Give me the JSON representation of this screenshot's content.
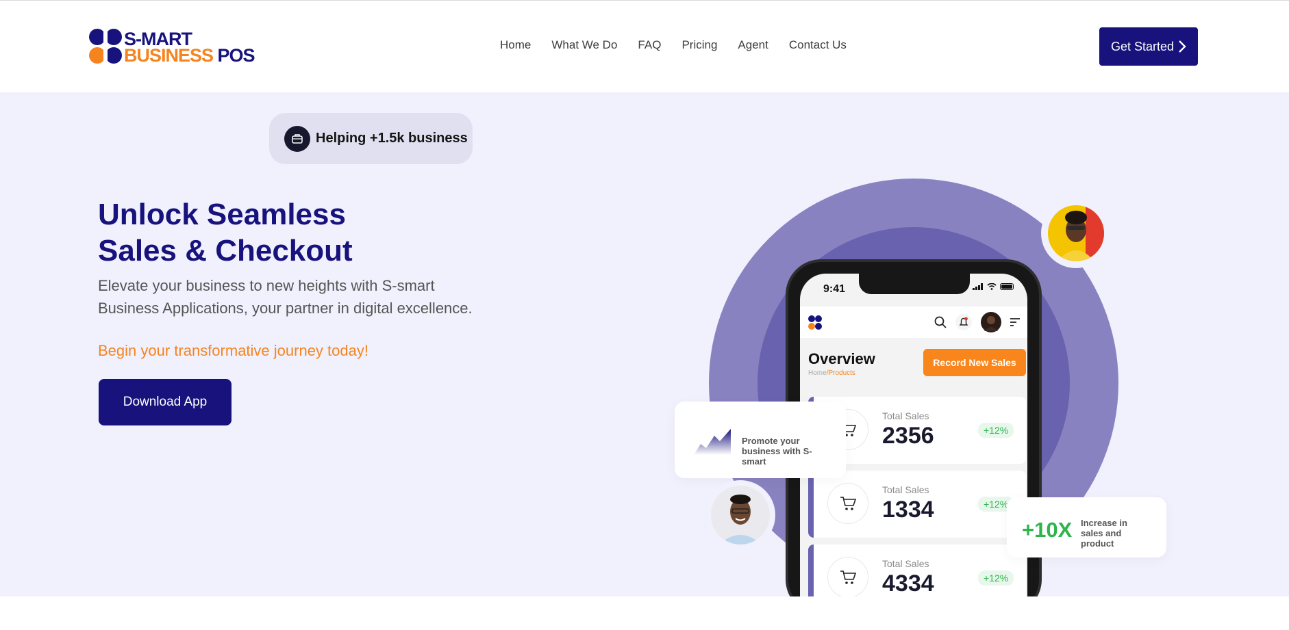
{
  "brand": {
    "line1": "S-MART",
    "line2_a": "BUSINESS",
    "line2_b": " POS",
    "colors": {
      "navy": "#17127c",
      "orange": "#f5841f"
    }
  },
  "nav": {
    "items": [
      {
        "label": "Home"
      },
      {
        "label": "What We Do"
      },
      {
        "label": "FAQ"
      },
      {
        "label": "Pricing"
      },
      {
        "label": "Agent"
      },
      {
        "label": "Contact Us"
      }
    ],
    "cta_label": "Get Started",
    "cta_icon": "chevron-right-icon"
  },
  "hero": {
    "badge": {
      "icon": "briefcase-icon",
      "text": "Helping +1.5k business"
    },
    "headline_line1": "Unlock Seamless",
    "headline_line2": "Sales & Checkout",
    "subtext": "Elevate your business to new heights with S-smart Business Applications, your partner in digital excellence.",
    "tagline": "Begin your transformative journey today!",
    "download_label": "Download App"
  },
  "phone": {
    "time": "9:41",
    "title": "Overview",
    "breadcrumb_home": "Home",
    "breadcrumb_current": "/Products",
    "record_label": "Record New Sales",
    "cards": [
      {
        "label": "Total Sales",
        "value": "2356",
        "change": "+12%"
      },
      {
        "label": "Total Sales",
        "value": "1334",
        "change": "+12%"
      },
      {
        "label": "Total Sales",
        "value": "4334",
        "change": "+12%"
      }
    ]
  },
  "floating": {
    "promo_text": "Promote your business with S-smart",
    "stat_value": "+10X",
    "stat_text": "Increase in sales and product"
  }
}
